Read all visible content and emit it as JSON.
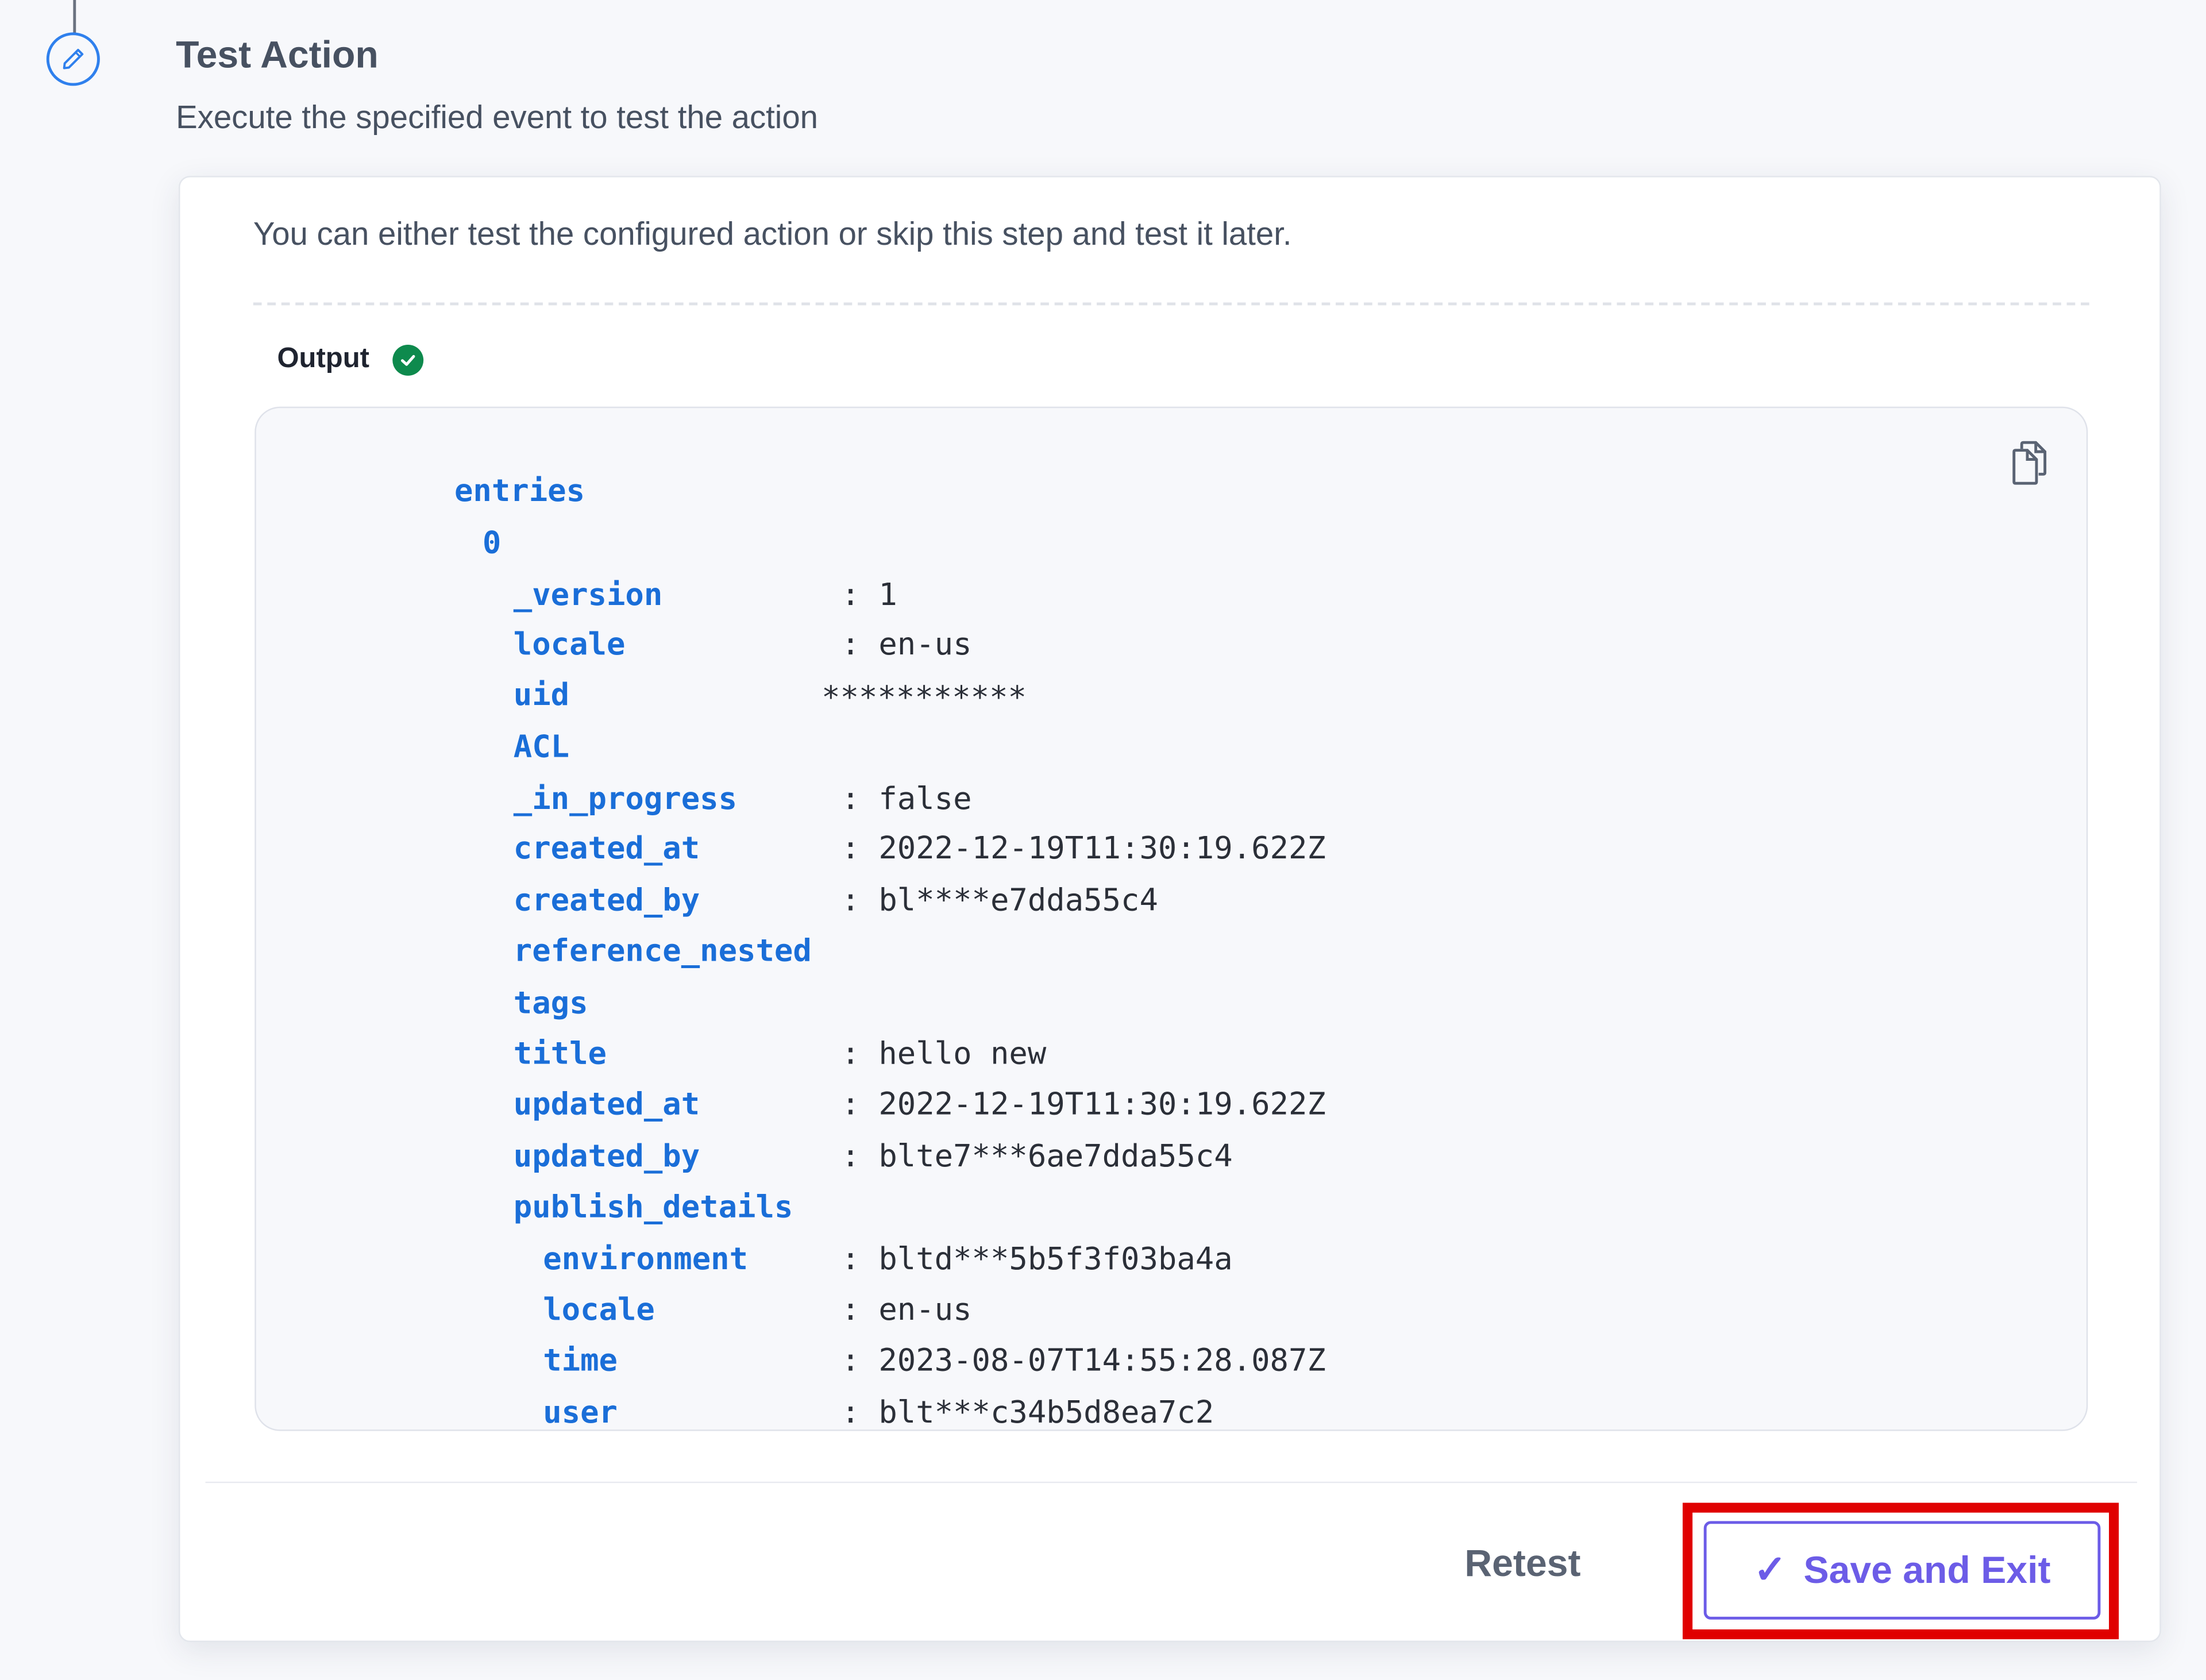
{
  "step": {
    "title": "Test Action",
    "subtitle": "Execute the specified event to test the action",
    "icon": "pencil-icon"
  },
  "card": {
    "intro": "You can either test the configured action or skip this step and test it later.",
    "output_label": "Output",
    "output_status": "success"
  },
  "output": {
    "lines": [
      {
        "key": "entries",
        "value": ""
      },
      {
        "key": "0",
        "value": ""
      },
      {
        "key": "_version",
        "value": "1"
      },
      {
        "key": "locale",
        "value": "en-us"
      },
      {
        "key": "uid",
        "value": "***********"
      },
      {
        "key": "ACL",
        "value": ""
      },
      {
        "key": "_in_progress",
        "value": "false"
      },
      {
        "key": "created_at",
        "value": "2022-12-19T11:30:19.622Z"
      },
      {
        "key": "created_by",
        "value": "bl****e7dda55c4"
      },
      {
        "key": "reference_nested",
        "value": ""
      },
      {
        "key": "tags",
        "value": ""
      },
      {
        "key": "title",
        "value": "hello new"
      },
      {
        "key": "updated_at",
        "value": "2022-12-19T11:30:19.622Z"
      },
      {
        "key": "updated_by",
        "value": "blte7***6ae7dda55c4"
      },
      {
        "key": "publish_details",
        "value": ""
      },
      {
        "key": "environment",
        "value": "bltd***5b5f3f03ba4a"
      },
      {
        "key": "locale",
        "value": "en-us"
      },
      {
        "key": "time",
        "value": "2023-08-07T14:55:28.087Z"
      },
      {
        "key": "user",
        "value": "blt***c34b5d8ea7c2"
      }
    ]
  },
  "footer": {
    "retest_label": "Retest",
    "save_label": "Save and Exit"
  },
  "colors": {
    "accent": "#6c5ce7",
    "key": "#1a6ed8",
    "highlight": "#e00000",
    "success": "#0e8a4d"
  }
}
